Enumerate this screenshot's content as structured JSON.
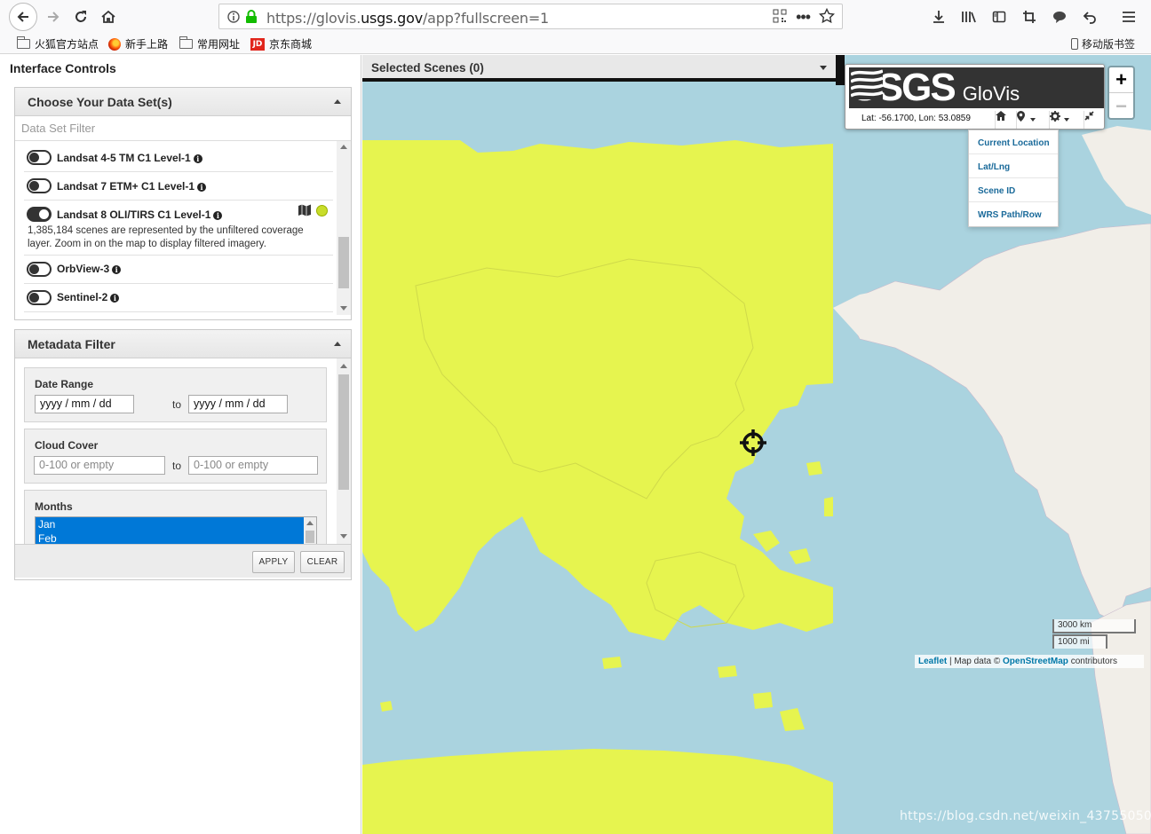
{
  "browser": {
    "url_prefix": "https://glovis.",
    "url_domain": "usgs.gov",
    "url_suffix": "/app?fullscreen=1",
    "bookmarks": [
      {
        "label": "火狐官方站点",
        "icon": "folder-icon"
      },
      {
        "label": "新手上路",
        "icon": "firefox-icon"
      },
      {
        "label": "常用网址",
        "icon": "folder-icon"
      },
      {
        "label": "京东商城",
        "icon": "jd-icon"
      }
    ],
    "mobile_bookmarks": "移动版书签"
  },
  "sidebar": {
    "title": "Interface Controls",
    "datasets_panel": {
      "title": "Choose Your Data Set(s)",
      "filter_placeholder": "Data Set Filter",
      "items": [
        {
          "name": "Landsat 4-5 TM C1 Level-1",
          "enabled": false
        },
        {
          "name": "Landsat 7 ETM+ C1 Level-1",
          "enabled": false
        },
        {
          "name": "Landsat 8 OLI/TIRS C1 Level-1",
          "enabled": true,
          "description": "1,385,184 scenes are represented by the unfiltered coverage layer. Zoom in on the map to display filtered imagery."
        },
        {
          "name": "OrbView-3",
          "enabled": false
        },
        {
          "name": "Sentinel-2",
          "enabled": false
        }
      ]
    },
    "metadata_panel": {
      "title": "Metadata Filter",
      "date_range": {
        "label": "Date Range",
        "start": "yyyy / mm / dd",
        "to": "to",
        "end": "yyyy / mm / dd"
      },
      "cloud_cover": {
        "label": "Cloud Cover",
        "min_placeholder": "0-100 or empty",
        "to": "to",
        "max_placeholder": "0-100 or empty"
      },
      "months": {
        "label": "Months",
        "options": [
          "Jan",
          "Feb"
        ]
      },
      "apply_label": "APPLY",
      "clear_label": "CLEAR"
    }
  },
  "map": {
    "selected_scenes": "Selected Scenes (0)",
    "logo_text": "USGS",
    "app_name": "GloVis",
    "coordinates": "Lat: -56.1700, Lon: 53.0859",
    "location_menu": [
      "Current Location",
      "Lat/Lng",
      "Scene ID",
      "WRS Path/Row"
    ],
    "zoom_in": "+",
    "zoom_out": "−",
    "scale_km": "3000 km",
    "scale_mi": "1000 mi",
    "attribution_leaflet": "Leaflet",
    "attribution_mid": " | Map data © ",
    "attribution_osm": "OpenStreetMap",
    "attribution_end": " contributors",
    "watermark": "https://blog.csdn.net/weixin_43755050",
    "colors": {
      "ocean": "#aad3df",
      "coverage": "#e6f44f",
      "land": "#f1eee8"
    }
  }
}
